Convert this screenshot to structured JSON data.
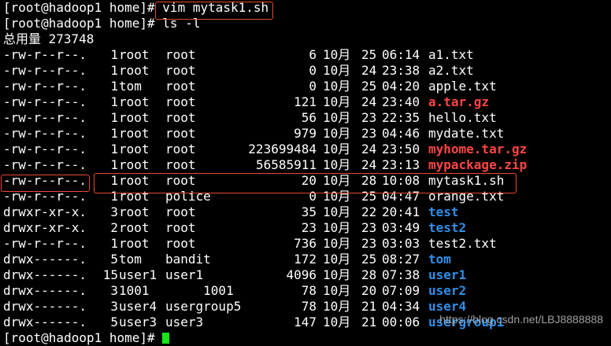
{
  "terminal": {
    "prompt1": "[root@hadoop1 home]# ",
    "cmd1": "vim mytask1.sh",
    "prompt2": "[root@hadoop1 home]# ",
    "cmd2": "ls -l",
    "total": "总用量 273748",
    "entries": [
      {
        "perm": "-rw-r--r--.",
        "links": "1",
        "owner": "root",
        "group": "root",
        "size": "6",
        "month": "10月",
        "day": "25",
        "time": "06:14",
        "name": "a1.txt",
        "color": "white"
      },
      {
        "perm": "-rw-r--r--.",
        "links": "1",
        "owner": "root",
        "group": "root",
        "size": "0",
        "month": "10月",
        "day": "24",
        "time": "23:38",
        "name": "a2.txt",
        "color": "white"
      },
      {
        "perm": "-rw-r--r--.",
        "links": "1",
        "owner": "tom",
        "group": "root",
        "size": "0",
        "month": "10月",
        "day": "25",
        "time": "04:20",
        "name": "apple.txt",
        "color": "white"
      },
      {
        "perm": "-rw-r--r--.",
        "links": "1",
        "owner": "root",
        "group": "root",
        "size": "121",
        "month": "10月",
        "day": "24",
        "time": "23:40",
        "name": "a.tar.gz",
        "color": "red"
      },
      {
        "perm": "-rw-r--r--.",
        "links": "1",
        "owner": "root",
        "group": "root",
        "size": "56",
        "month": "10月",
        "day": "23",
        "time": "22:35",
        "name": "hello.txt",
        "color": "white"
      },
      {
        "perm": "-rw-r--r--.",
        "links": "1",
        "owner": "root",
        "group": "root",
        "size": "979",
        "month": "10月",
        "day": "23",
        "time": "04:46",
        "name": "mydate.txt",
        "color": "white"
      },
      {
        "perm": "-rw-r--r--.",
        "links": "1",
        "owner": "root",
        "group": "root",
        "size": "223699484",
        "month": "10月",
        "day": "24",
        "time": "23:50",
        "name": "myhome.tar.gz",
        "color": "red"
      },
      {
        "perm": "-rw-r--r--.",
        "links": "1",
        "owner": "root",
        "group": "root",
        "size": "56585911",
        "month": "10月",
        "day": "24",
        "time": "23:13",
        "name": "mypackage.zip",
        "color": "red"
      },
      {
        "perm": "-rw-r--r--.",
        "links": "1",
        "owner": "root",
        "group": "root",
        "size": "20",
        "month": "10月",
        "day": "28",
        "time": "10:08",
        "name": "mytask1.sh",
        "color": "white"
      },
      {
        "perm": "-rw-r--r--.",
        "links": "1",
        "owner": "root",
        "group": "police",
        "size": "0",
        "month": "10月",
        "day": "25",
        "time": "04:47",
        "name": "orange.txt",
        "color": "white"
      },
      {
        "perm": "drwxr-xr-x.",
        "links": "3",
        "owner": "root",
        "group": "root",
        "size": "35",
        "month": "10月",
        "day": "22",
        "time": "20:41",
        "name": "test",
        "color": "blue"
      },
      {
        "perm": "drwxr-xr-x.",
        "links": "2",
        "owner": "root",
        "group": "root",
        "size": "23",
        "month": "10月",
        "day": "23",
        "time": "03:49",
        "name": "test2",
        "color": "blue"
      },
      {
        "perm": "-rw-r--r--.",
        "links": "1",
        "owner": "root",
        "group": "root",
        "size": "736",
        "month": "10月",
        "day": "23",
        "time": "03:03",
        "name": "test2.txt",
        "color": "white"
      },
      {
        "perm": "drwx------.",
        "links": "5",
        "owner": "tom",
        "group": "bandit",
        "size": "172",
        "month": "10月",
        "day": "25",
        "time": "08:27",
        "name": "tom",
        "color": "blue"
      },
      {
        "perm": "drwx------.",
        "links": "15",
        "owner": "user1",
        "group": "user1",
        "size": "4096",
        "month": "10月",
        "day": "28",
        "time": "07:38",
        "name": "user1",
        "color": "blue"
      },
      {
        "perm": "drwx------.",
        "links": "3",
        "owner": "1001",
        "group": "     1001",
        "size": "78",
        "month": "10月",
        "day": "20",
        "time": "07:09",
        "name": "user2",
        "color": "blue"
      },
      {
        "perm": "drwx------.",
        "links": "3",
        "owner": "user4",
        "group": "usergroup5",
        "size": "78",
        "month": "10月",
        "day": "21",
        "time": "04:34",
        "name": "user4",
        "color": "blue"
      },
      {
        "perm": "drwx------.",
        "links": "5",
        "owner": "user3",
        "group": "user3",
        "size": "147",
        "month": "10月",
        "day": "21",
        "time": "00:06",
        "name": "usergroup1",
        "color": "blue"
      }
    ],
    "prompt3": "[root@hadoop1 home]# "
  },
  "watermark": "https://blog.csdn.net/LBJ8888888",
  "colors": {
    "background": "#000000",
    "text": "#ffffff",
    "archive": "#ff4545",
    "directory": "#2e8fe8",
    "cursor": "#19e619",
    "highlight": "#e74a2f"
  }
}
